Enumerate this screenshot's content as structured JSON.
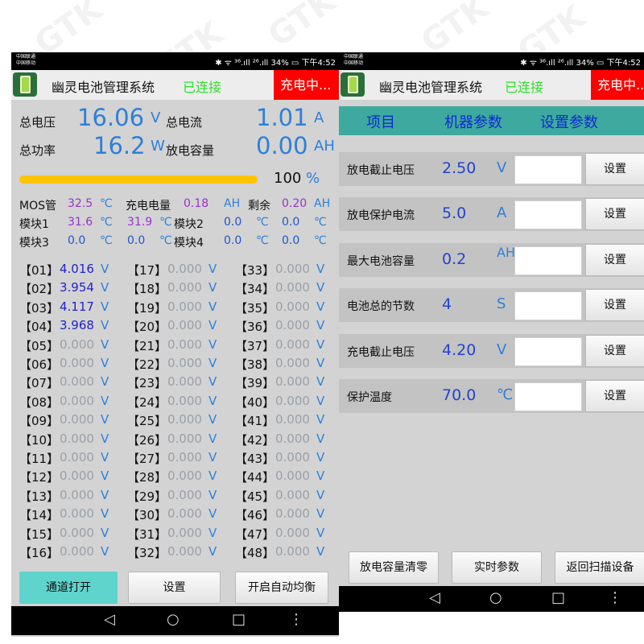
{
  "watermark": "GTK",
  "status": {
    "carrier1": "中国联通",
    "carrier2": "中国移动",
    "right": "✱ ᯤ ³⁶.ıll ²⁶.ıll 34% ▭ 下午4:52"
  },
  "app": {
    "title": "幽灵电池管理系统",
    "connected": "已连接",
    "charging": "充电中..."
  },
  "main": {
    "total_voltage_label": "总电压",
    "total_voltage_value": "16.06",
    "total_voltage_unit": "V",
    "total_current_label": "总电流",
    "total_current_value": "1.01",
    "total_current_unit": "A",
    "total_power_label": "总功率",
    "total_power_value": "16.2",
    "total_power_unit": "W",
    "discharge_capacity_label": "放电容量",
    "discharge_capacity_value": "0.00",
    "discharge_capacity_unit": "AH",
    "progress_percent": 100,
    "progress_text": "100",
    "progress_unit": "%",
    "mos_label": "MOS管",
    "mos_value": "32.5",
    "mos_unit": "℃",
    "charge_label": "充电电量",
    "charge_value": "0.18",
    "charge_unit": "AH",
    "remain_label": "剩余",
    "remain_value": "0.20",
    "remain_unit": "AH",
    "module1_label": "模块1",
    "module1_v1": "31.6",
    "module1_v2": "31.9",
    "module2_label": "模块2",
    "module2_v1": "0.0",
    "module2_v2": "0.0",
    "module3_label": "模块3",
    "module3_v1": "0.0",
    "module3_v2": "0.0",
    "module4_label": "模块4",
    "module4_v1": "0.0",
    "module4_v2": "0.0",
    "temp_unit": "℃",
    "cell_unit": "V",
    "cells": [
      {
        "idx": "【01】",
        "val": "4.016"
      },
      {
        "idx": "【02】",
        "val": "3.954"
      },
      {
        "idx": "【03】",
        "val": "4.117"
      },
      {
        "idx": "【04】",
        "val": "3.968"
      },
      {
        "idx": "【05】",
        "val": "0.000"
      },
      {
        "idx": "【06】",
        "val": "0.000"
      },
      {
        "idx": "【07】",
        "val": "0.000"
      },
      {
        "idx": "【08】",
        "val": "0.000"
      },
      {
        "idx": "【09】",
        "val": "0.000"
      },
      {
        "idx": "【10】",
        "val": "0.000"
      },
      {
        "idx": "【11】",
        "val": "0.000"
      },
      {
        "idx": "【12】",
        "val": "0.000"
      },
      {
        "idx": "【13】",
        "val": "0.000"
      },
      {
        "idx": "【14】",
        "val": "0.000"
      },
      {
        "idx": "【15】",
        "val": "0.000"
      },
      {
        "idx": "【16】",
        "val": "0.000"
      },
      {
        "idx": "【17】",
        "val": "0.000"
      },
      {
        "idx": "【18】",
        "val": "0.000"
      },
      {
        "idx": "【19】",
        "val": "0.000"
      },
      {
        "idx": "【20】",
        "val": "0.000"
      },
      {
        "idx": "【21】",
        "val": "0.000"
      },
      {
        "idx": "【22】",
        "val": "0.000"
      },
      {
        "idx": "【23】",
        "val": "0.000"
      },
      {
        "idx": "【24】",
        "val": "0.000"
      },
      {
        "idx": "【25】",
        "val": "0.000"
      },
      {
        "idx": "【26】",
        "val": "0.000"
      },
      {
        "idx": "【27】",
        "val": "0.000"
      },
      {
        "idx": "【28】",
        "val": "0.000"
      },
      {
        "idx": "【29】",
        "val": "0.000"
      },
      {
        "idx": "【30】",
        "val": "0.000"
      },
      {
        "idx": "【31】",
        "val": "0.000"
      },
      {
        "idx": "【32】",
        "val": "0.000"
      },
      {
        "idx": "【33】",
        "val": "0.000"
      },
      {
        "idx": "【34】",
        "val": "0.000"
      },
      {
        "idx": "【35】",
        "val": "0.000"
      },
      {
        "idx": "【36】",
        "val": "0.000"
      },
      {
        "idx": "【37】",
        "val": "0.000"
      },
      {
        "idx": "【38】",
        "val": "0.000"
      },
      {
        "idx": "【39】",
        "val": "0.000"
      },
      {
        "idx": "【40】",
        "val": "0.000"
      },
      {
        "idx": "【41】",
        "val": "0.000"
      },
      {
        "idx": "【42】",
        "val": "0.000"
      },
      {
        "idx": "【43】",
        "val": "0.000"
      },
      {
        "idx": "【44】",
        "val": "0.000"
      },
      {
        "idx": "【45】",
        "val": "0.000"
      },
      {
        "idx": "【46】",
        "val": "0.000"
      },
      {
        "idx": "【47】",
        "val": "0.000"
      },
      {
        "idx": "【48】",
        "val": "0.000"
      }
    ],
    "buttons": {
      "open_channel": "通道打开",
      "settings": "设置",
      "auto_balance": "开启自动均衡"
    }
  },
  "params": {
    "header_item": "项目",
    "header_device": "机器参数",
    "header_setting": "设置参数",
    "set_label": "设置",
    "rows": [
      {
        "label": "放电截止电压",
        "value": "2.50",
        "unit": "V"
      },
      {
        "label": "放电保护电流",
        "value": "5.0",
        "unit": "A"
      },
      {
        "label": "最大电池容量",
        "value": "0.2",
        "unit": "AH"
      },
      {
        "label": "电池总的节数",
        "value": "4",
        "unit": "S"
      },
      {
        "label": "充电截止电压",
        "value": "4.20",
        "unit": "V"
      },
      {
        "label": "保护温度",
        "value": "70.0",
        "unit": "℃"
      }
    ],
    "buttons": {
      "clear_capacity": "放电容量清零",
      "realtime": "实时参数",
      "back_scan": "返回扫描设备"
    }
  },
  "nav": {
    "back": "◁",
    "home": "○",
    "recent": "□",
    "more": "⋮"
  }
}
